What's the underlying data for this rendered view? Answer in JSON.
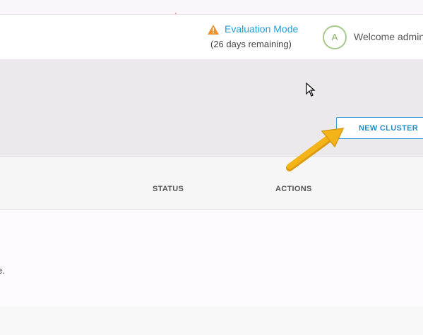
{
  "header": {
    "evaluation": {
      "title": "Evaluation Mode",
      "remaining": "(26 days remaining)",
      "icon": "warning-icon",
      "icon_color": "#f0922b",
      "title_color": "#1f9fd8"
    },
    "user": {
      "avatar_initial": "A",
      "welcome_text": "Welcome admin",
      "avatar_color": "#7fb25e"
    }
  },
  "toolbar": {
    "new_cluster_label": "NEW CLUSTER",
    "accent": "#3aa1d8"
  },
  "table": {
    "columns": [
      "STATUS",
      "ACTIONS"
    ],
    "empty_message": "e."
  },
  "annotation": {
    "arrow_color": "#f5b31a"
  }
}
